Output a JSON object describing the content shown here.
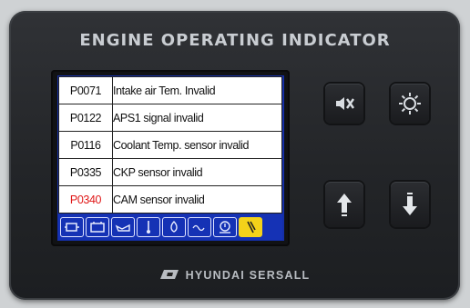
{
  "panel": {
    "title": "ENGINE OPERATING INDICATOR",
    "brand": "HYUNDAI SERSALL"
  },
  "fault_codes": [
    {
      "code": "P0071",
      "description": "Intake air Tem. Invalid",
      "code_color": "#111111"
    },
    {
      "code": "P0122",
      "description": "APS1 signal invalid",
      "code_color": "#111111"
    },
    {
      "code": "P0116",
      "description": "Coolant Temp. sensor invalid",
      "code_color": "#111111"
    },
    {
      "code": "P0335",
      "description": "CKP sensor invalid",
      "code_color": "#111111"
    },
    {
      "code": "P0340",
      "description": "CAM sensor invalid",
      "code_color": "#e01919"
    }
  ],
  "status_icons": [
    {
      "name": "engine-icon",
      "active": false
    },
    {
      "name": "battery-icon",
      "active": false
    },
    {
      "name": "oil-can-icon",
      "active": false
    },
    {
      "name": "thermometer-icon",
      "active": false
    },
    {
      "name": "oil-pressure-icon",
      "active": false
    },
    {
      "name": "glow-plug-icon",
      "active": false
    },
    {
      "name": "warning-icon",
      "active": false
    },
    {
      "name": "fuel-filter-icon",
      "active": true
    }
  ],
  "buttons": [
    "mute-icon",
    "lamp-test-icon",
    "arrow-up-icon",
    "arrow-down-icon"
  ],
  "colors": {
    "screen_blue": "#152fa8",
    "alert_red": "#e01919",
    "active_yellow": "#f4d21a"
  }
}
